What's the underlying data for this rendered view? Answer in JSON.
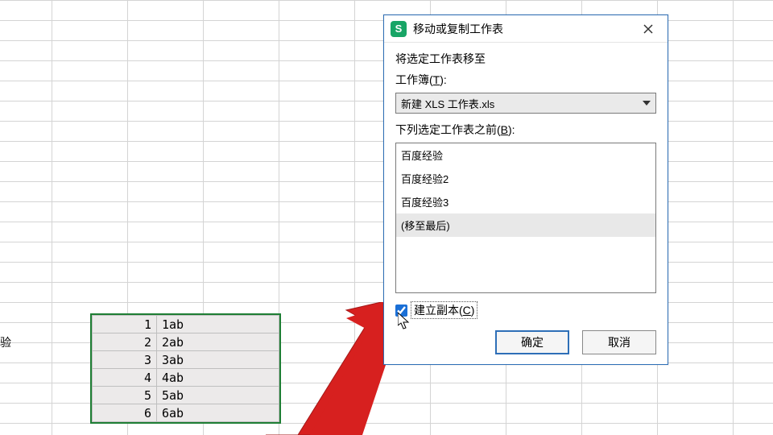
{
  "edge_label": "验",
  "table": {
    "rows": [
      {
        "a": "1",
        "b": "1ab"
      },
      {
        "a": "2",
        "b": "2ab"
      },
      {
        "a": "3",
        "b": "3ab"
      },
      {
        "a": "4",
        "b": "4ab"
      },
      {
        "a": "5",
        "b": "5ab"
      },
      {
        "a": "6",
        "b": "6ab"
      }
    ]
  },
  "dialog": {
    "app_icon_letter": "S",
    "title": "移动或复制工作表",
    "move_caption": "将选定工作表移至",
    "workbook_label_pre": "工作簿(",
    "workbook_label_u": "T",
    "workbook_label_post": "):",
    "workbook_selected": "新建 XLS 工作表.xls",
    "before_label_pre": "下列选定工作表之前(",
    "before_label_u": "B",
    "before_label_post": "):",
    "sheets": [
      "百度经验",
      "百度经验2",
      "百度经验3",
      "(移至最后)"
    ],
    "selected_index": 3,
    "copy_label_pre": "建立副本(",
    "copy_label_u": "C",
    "copy_label_post": ")",
    "copy_checked": true,
    "ok": "确定",
    "cancel": "取消"
  },
  "colors": {
    "accent": "#2e6fb7",
    "green": "#18a566",
    "arrow": "#d7201f"
  }
}
